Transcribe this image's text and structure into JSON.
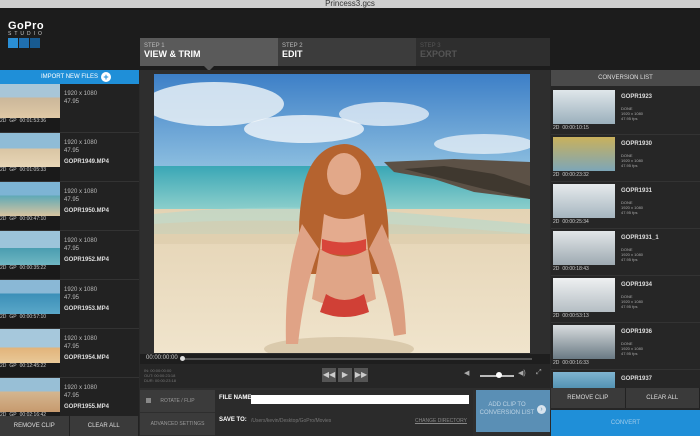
{
  "window": {
    "title": "Princess3.gcs"
  },
  "logo": {
    "brand": "GoPro",
    "product": "STUDIO"
  },
  "steps": [
    {
      "num": "STEP 1",
      "name": "VIEW & TRIM"
    },
    {
      "num": "STEP 2",
      "name": "EDIT"
    },
    {
      "num": "STEP 3",
      "name": "EXPORT"
    }
  ],
  "import": {
    "label": "IMPORT NEW FILES"
  },
  "files": [
    {
      "name": "",
      "res": "1920 x 1080",
      "fps": "47.95",
      "dim": "2D",
      "mode": "GP",
      "duration": "00:01:53:36"
    },
    {
      "name": "GOPR1949.MP4",
      "res": "1920 x 1080",
      "fps": "47.95",
      "dim": "2D",
      "mode": "GP",
      "duration": "00:01:05:33"
    },
    {
      "name": "GOPR1950.MP4",
      "res": "1920 x 1080",
      "fps": "47.95",
      "dim": "2D",
      "mode": "GP",
      "duration": "00:00:47:10"
    },
    {
      "name": "GOPR1952.MP4",
      "res": "1920 x 1080",
      "fps": "47.95",
      "dim": "2D",
      "mode": "GP",
      "duration": "00:00:35:22"
    },
    {
      "name": "GOPR1953.MP4",
      "res": "1920 x 1080",
      "fps": "47.95",
      "dim": "2D",
      "mode": "GP",
      "duration": "00:00:57:10"
    },
    {
      "name": "GOPR1954.MP4",
      "res": "1920 x 1080",
      "fps": "47.95",
      "dim": "2D",
      "mode": "GP",
      "duration": "00:12:45:22"
    },
    {
      "name": "GOPR1955.MP4",
      "res": "1920 x 1080",
      "fps": "47.95",
      "dim": "2D",
      "mode": "GP",
      "duration": "00:02:16:42"
    }
  ],
  "left_buttons": {
    "remove": "REMOVE CLIP",
    "clear": "CLEAR ALL"
  },
  "timeline": {
    "timecode": "00:00:00:00"
  },
  "transport": {
    "in_label": "IN: 00:00:00:00",
    "out_label": "OUT: 00:00:23:18",
    "dur_label": "DUR: 00:00:23:18",
    "rewind": "◀◀",
    "play": "▶",
    "forward": "▶▶",
    "vol_low": "◀",
    "vol_high": "◀)",
    "fullscreen": "⤢"
  },
  "options": {
    "rotate": "ROTATE / FLIP",
    "advanced": "ADVANCED SETTINGS"
  },
  "fields": {
    "file_name_label": "FILE NAME:",
    "file_name_value": "",
    "save_to_label": "SAVE TO:",
    "save_to_path": "/Users/kevin/Desktop/GoPro/Movies",
    "change_label": "CHANGE DIRECTORY"
  },
  "add_button": {
    "label": "ADD CLIP TO CONVERSION LIST"
  },
  "conversion": {
    "header": "CONVERSION LIST",
    "items": [
      {
        "name": "GOPR1923",
        "status": "DONE",
        "res": "1920 x 1080",
        "fps": "47.95 fps",
        "dim": "2D",
        "duration": "00:00:10:15"
      },
      {
        "name": "GOPR1930",
        "status": "DONE",
        "res": "1920 x 1080",
        "fps": "47.95 fps",
        "dim": "2D",
        "duration": "00:00:23:32"
      },
      {
        "name": "GOPR1931",
        "status": "DONE",
        "res": "1920 x 1080",
        "fps": "47.95 fps",
        "dim": "2D",
        "duration": "00:00:25:34"
      },
      {
        "name": "GOPR1931_1",
        "status": "DONE",
        "res": "1920 x 1080",
        "fps": "47.95 fps",
        "dim": "2D",
        "duration": "00:00:18:43"
      },
      {
        "name": "GOPR1934",
        "status": "DONE",
        "res": "1920 x 1080",
        "fps": "47.95 fps",
        "dim": "2D",
        "duration": "00:00:53:13"
      },
      {
        "name": "GOPR1936",
        "status": "DONE",
        "res": "1920 x 1080",
        "fps": "47.95 fps",
        "dim": "2D",
        "duration": "00:00:16:33"
      },
      {
        "name": "GOPR1937",
        "status": "",
        "res": "",
        "fps": "",
        "dim": "2D",
        "duration": ""
      }
    ]
  },
  "right_buttons": {
    "remove": "REMOVE CLIP",
    "clear": "CLEAR ALL"
  },
  "convert_button": {
    "label": "CONVERT"
  }
}
